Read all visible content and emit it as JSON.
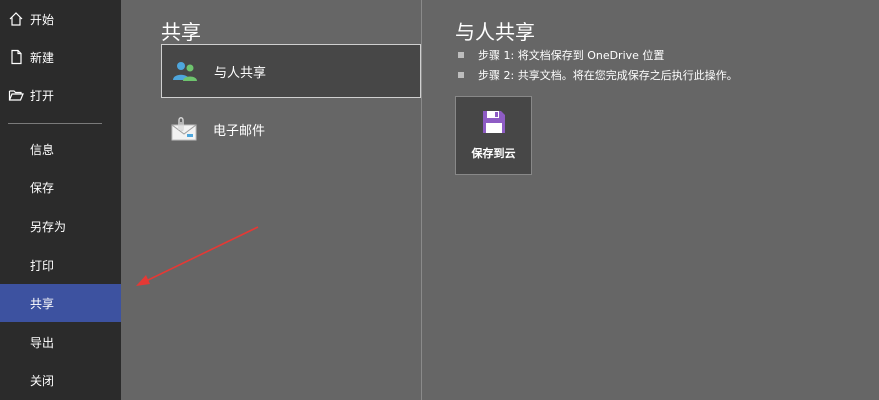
{
  "sidebar": {
    "items": [
      {
        "label": "开始",
        "icon": "home-icon"
      },
      {
        "label": "新建",
        "icon": "new-document-icon"
      },
      {
        "label": "打开",
        "icon": "open-folder-icon"
      },
      {
        "label": "信息"
      },
      {
        "label": "保存"
      },
      {
        "label": "另存为"
      },
      {
        "label": "打印"
      },
      {
        "label": "共享",
        "active": true
      },
      {
        "label": "导出"
      },
      {
        "label": "关闭"
      }
    ]
  },
  "share_panel": {
    "title": "共享",
    "options": [
      {
        "label": "与人共享",
        "icon": "people-icon",
        "selected": true
      },
      {
        "label": "电子邮件",
        "icon": "email-icon"
      }
    ]
  },
  "detail_panel": {
    "title": "与人共享",
    "steps": [
      "步骤 1: 将文档保存到 OneDrive 位置",
      "步骤 2: 共享文档。将在您完成保存之后执行此操作。"
    ],
    "save_button": {
      "label": "保存到云",
      "icon": "floppy-disk-icon"
    }
  },
  "colors": {
    "sidebar_bg": "#2b2b2b",
    "content_bg": "#666666",
    "active_item": "#3d52a0",
    "annotation_arrow": "#e53935",
    "save_icon": "#8e5cc4"
  }
}
